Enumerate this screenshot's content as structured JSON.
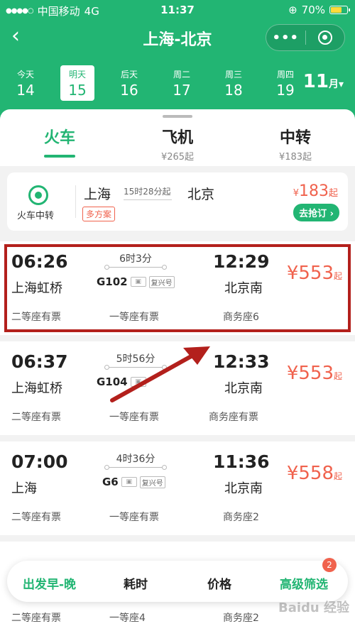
{
  "status": {
    "carrier": "中国移动",
    "network": "4G",
    "time": "11:37",
    "battery": "70%",
    "battery_level": 0.7
  },
  "nav": {
    "title": "上海-北京"
  },
  "dates": [
    {
      "week": "今天",
      "day": "14"
    },
    {
      "week": "明天",
      "day": "15"
    },
    {
      "week": "后天",
      "day": "16"
    },
    {
      "week": "周二",
      "day": "17"
    },
    {
      "week": "周三",
      "day": "18"
    },
    {
      "week": "周四",
      "day": "19"
    }
  ],
  "active_date": 1,
  "month": {
    "num": "11",
    "unit": "月"
  },
  "tabs": [
    {
      "title": "火车",
      "sub": ""
    },
    {
      "title": "飞机",
      "sub": "¥265起"
    },
    {
      "title": "中转",
      "sub": "¥183起"
    }
  ],
  "transfer": {
    "label": "火车中转",
    "from": "上海",
    "to": "北京",
    "duration": "15时28分起",
    "badge": "多方案",
    "price_sym": "¥",
    "price": "183",
    "price_unit": "起",
    "button": "去抢订"
  },
  "trains": [
    {
      "dep": "06:26",
      "arr": "12:29",
      "from": "上海虹桥",
      "to": "北京南",
      "duration": "6时3分",
      "code": "G102",
      "tag": "复兴号",
      "price": "¥553",
      "unit": "起",
      "seat1": "二等座有票",
      "seat2": "一等座有票",
      "seat3": "商务座6"
    },
    {
      "dep": "06:37",
      "arr": "12:33",
      "from": "上海虹桥",
      "to": "北京南",
      "duration": "5时56分",
      "code": "G104",
      "tag": "",
      "price": "¥553",
      "unit": "起",
      "seat1": "二等座有票",
      "seat2": "一等座有票",
      "seat3": "商务座有票"
    },
    {
      "dep": "07:00",
      "arr": "11:36",
      "from": "上海",
      "to": "北京南",
      "duration": "4时36分",
      "code": "G6",
      "tag": "复兴号",
      "price": "¥558",
      "unit": "起",
      "seat1": "二等座有票",
      "seat2": "一等座有票",
      "seat3": "商务座2"
    }
  ],
  "filters": {
    "depart": "出发早-晚",
    "duration": "耗时",
    "price": "价格",
    "advanced": "高级筛选",
    "advanced_count": "2"
  },
  "bottom_seats": {
    "seat1": "二等座有票",
    "seat2": "一等座4",
    "seat3": "商务座2"
  },
  "watermark": "Baidu 经验",
  "colors": {
    "brand": "#22b573",
    "price": "#f0624d",
    "highlight": "#b3201c"
  }
}
